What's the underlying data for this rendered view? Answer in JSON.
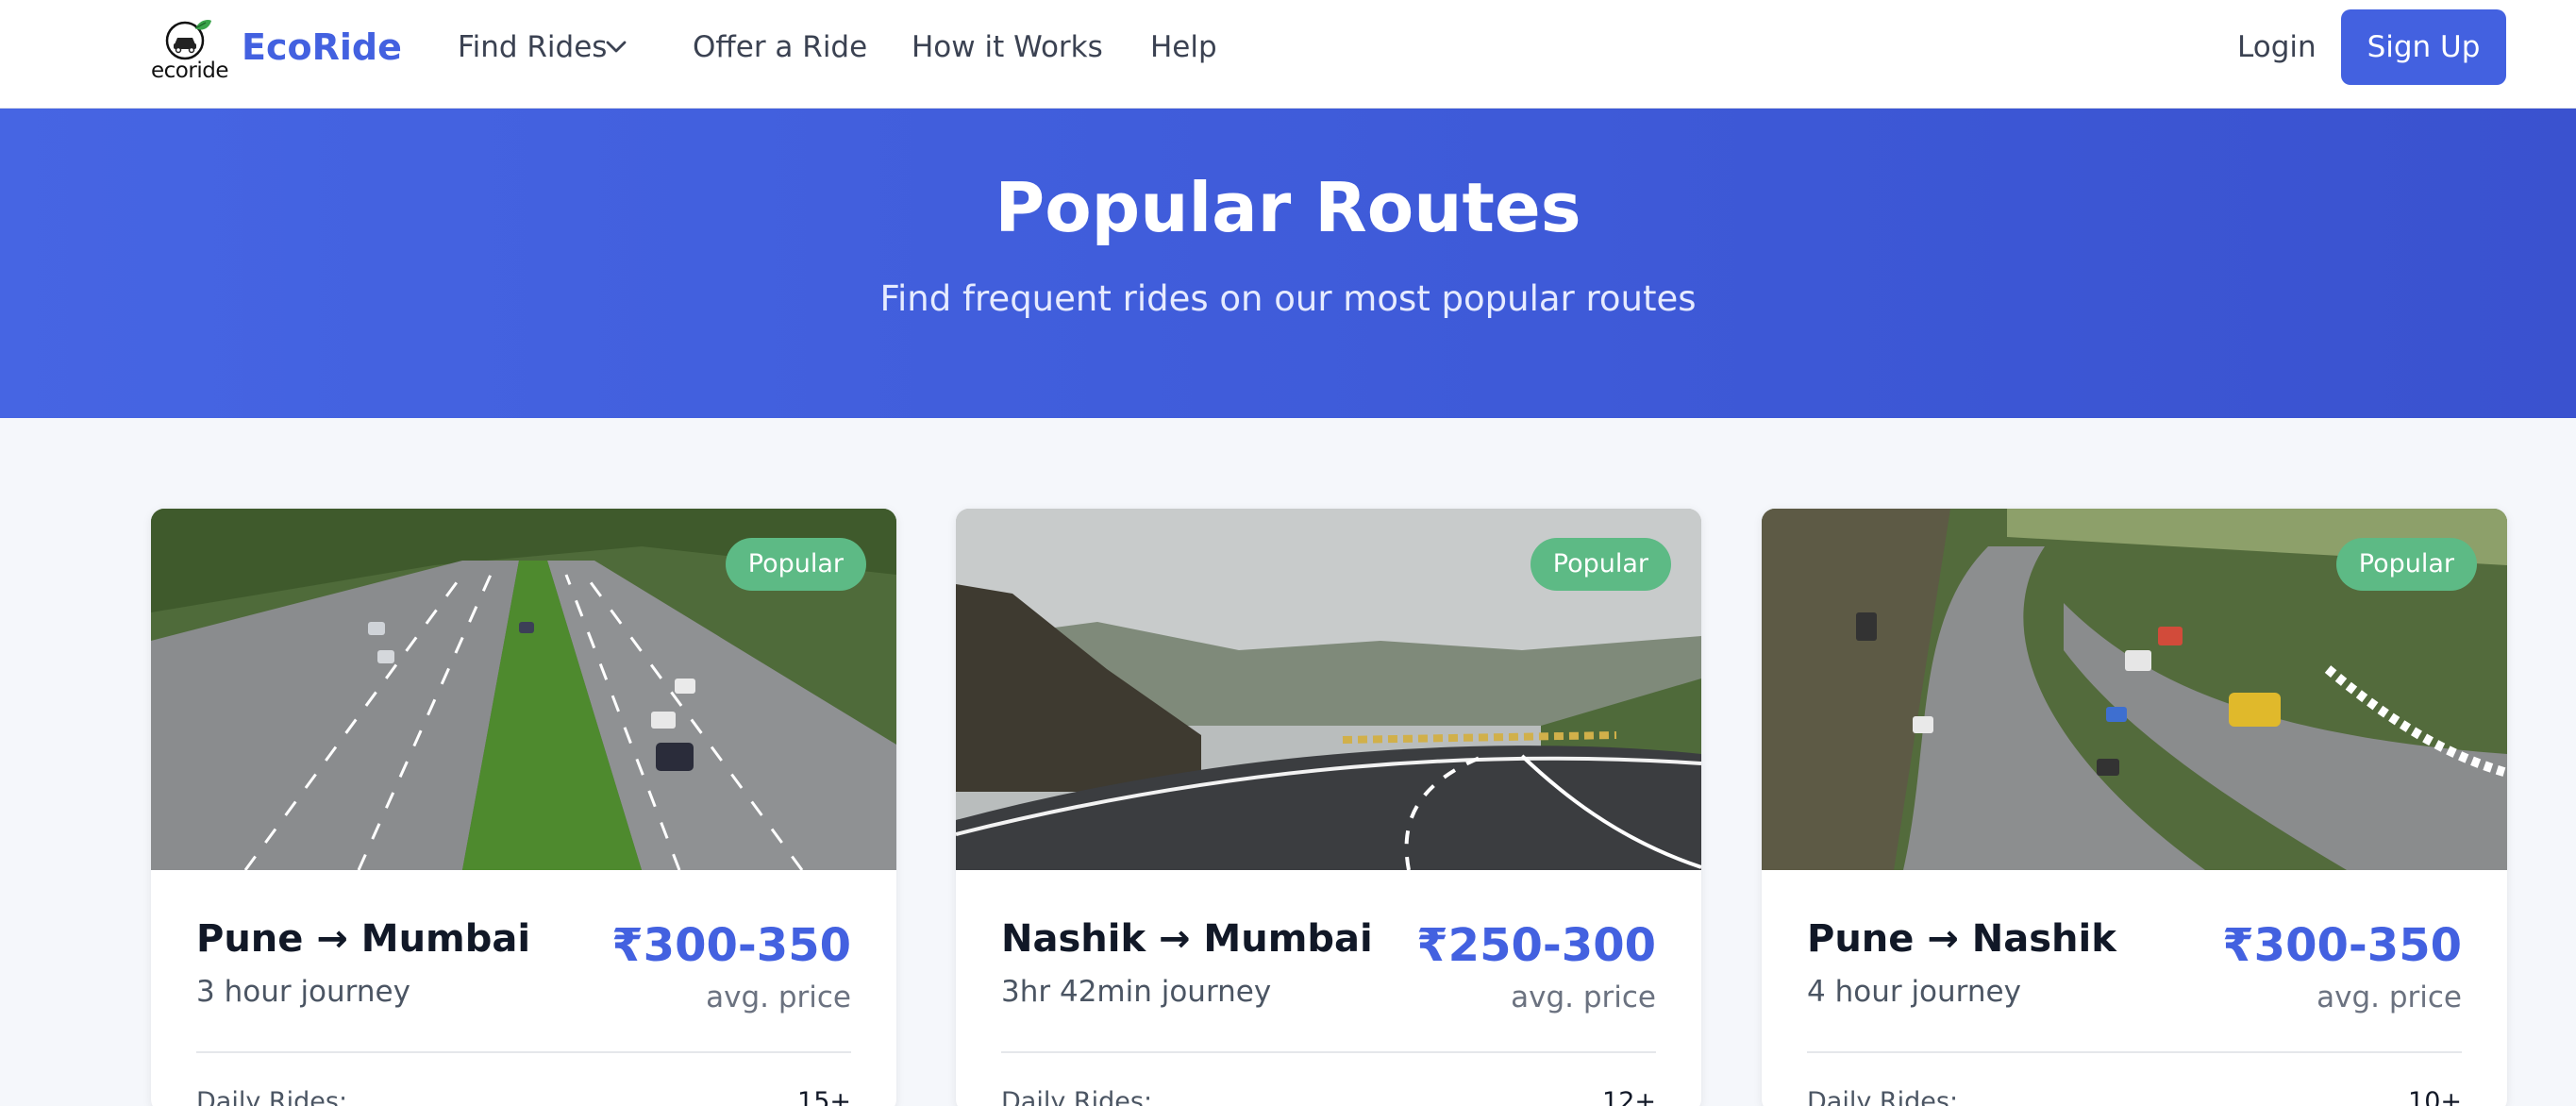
{
  "nav": {
    "logo_text": "ecoride",
    "brand": "EcoRide",
    "links": {
      "find_rides": "Find Rides",
      "offer_ride": "Offer a Ride",
      "how_it_works": "How it Works",
      "help": "Help"
    },
    "login": "Login",
    "signup": "Sign Up"
  },
  "hero": {
    "title": "Popular Routes",
    "subtitle": "Find frequent rides on our most popular routes"
  },
  "routes": [
    {
      "badge": "Popular",
      "route": "Pune → Mumbai",
      "duration": "3 hour journey",
      "price": "₹300-350",
      "price_label": "avg. price",
      "stat_label": "Daily Rides:",
      "stat_value": "15+"
    },
    {
      "badge": "Popular",
      "route": "Nashik → Mumbai",
      "duration": "3hr 42min journey",
      "price": "₹250-300",
      "price_label": "avg. price",
      "stat_label": "Daily Rides:",
      "stat_value": "12+"
    },
    {
      "badge": "Popular",
      "route": "Pune → Nashik",
      "duration": "4 hour journey",
      "price": "₹300-350",
      "price_label": "avg. price",
      "stat_label": "Daily Rides:",
      "stat_value": "10+"
    }
  ],
  "colors": {
    "accent": "#4361e0",
    "badge": "#5dba85",
    "hero_bg": "#4260dd"
  },
  "icons": {
    "logo": "car-leaf-icon",
    "dropdown": "chevron-down-icon"
  }
}
